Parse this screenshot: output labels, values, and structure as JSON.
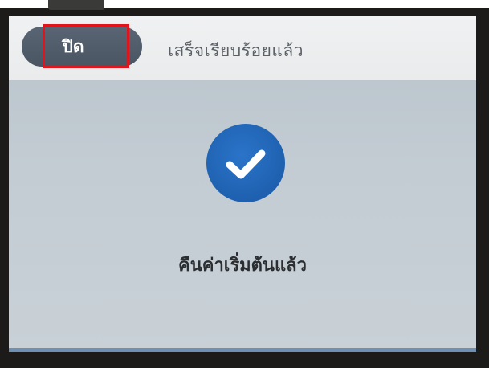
{
  "header": {
    "close_label": "ปิด",
    "title": "เสร็จเรียบร้อยแล้ว"
  },
  "main": {
    "status_icon": "checkmark-icon",
    "status_message": "คืนค่าเริ่มต้นแล้ว"
  },
  "colors": {
    "close_button": "#515d6b",
    "highlight": "#e0141a",
    "check_badge": "#1e5fae",
    "screen_background": "#c3ccd3",
    "header_background": "#eeeff0"
  }
}
